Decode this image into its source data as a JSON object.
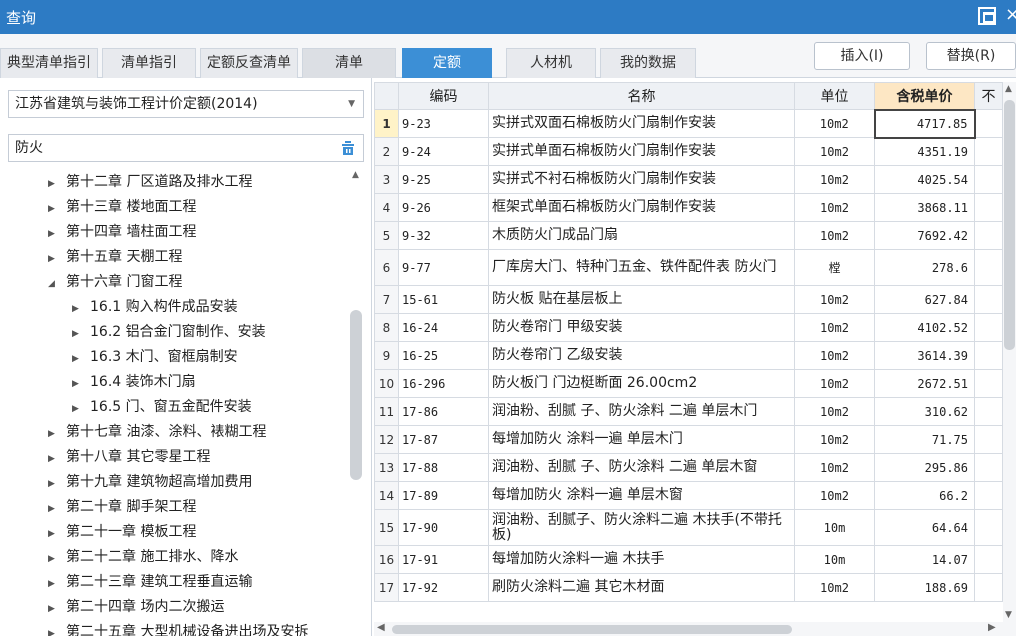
{
  "window": {
    "title": "查询"
  },
  "tabs": [
    {
      "label": "典型清单指引"
    },
    {
      "label": "清单指引"
    },
    {
      "label": "定额反查清单"
    },
    {
      "label": "清单"
    },
    {
      "label": "定额"
    },
    {
      "label": "人材机"
    },
    {
      "label": "我的数据"
    }
  ],
  "actions": {
    "insert": "插入(I)",
    "replace": "替换(R)"
  },
  "left": {
    "norm_select": "江苏省建筑与装饰工程计价定额(2014)",
    "search_value": "防火",
    "tree": [
      {
        "label": "第十二章 厂区道路及排水工程",
        "level": 0,
        "expanded": false
      },
      {
        "label": "第十三章 楼地面工程",
        "level": 0,
        "expanded": false
      },
      {
        "label": "第十四章 墙柱面工程",
        "level": 0,
        "expanded": false
      },
      {
        "label": "第十五章 天棚工程",
        "level": 0,
        "expanded": false
      },
      {
        "label": "第十六章 门窗工程",
        "level": 0,
        "expanded": true
      },
      {
        "label": "16.1 购入构件成品安装",
        "level": 1,
        "expanded": false
      },
      {
        "label": "16.2 铝合金门窗制作、安装",
        "level": 1,
        "expanded": false
      },
      {
        "label": "16.3 木门、窗框扇制安",
        "level": 1,
        "expanded": false
      },
      {
        "label": "16.4 装饰木门扇",
        "level": 1,
        "expanded": false
      },
      {
        "label": "16.5 门、窗五金配件安装",
        "level": 1,
        "expanded": false
      },
      {
        "label": "第十七章 油漆、涂料、裱糊工程",
        "level": 0,
        "expanded": false
      },
      {
        "label": "第十八章 其它零星工程",
        "level": 0,
        "expanded": false
      },
      {
        "label": "第十九章 建筑物超高增加费用",
        "level": 0,
        "expanded": false
      },
      {
        "label": "第二十章 脚手架工程",
        "level": 0,
        "expanded": false
      },
      {
        "label": "第二十一章 模板工程",
        "level": 0,
        "expanded": false
      },
      {
        "label": "第二十二章 施工排水、降水",
        "level": 0,
        "expanded": false
      },
      {
        "label": "第二十三章 建筑工程垂直运输",
        "level": 0,
        "expanded": false
      },
      {
        "label": "第二十四章 场内二次搬运",
        "level": 0,
        "expanded": false
      },
      {
        "label": "第二十五章 大型机械设备进出场及安拆",
        "level": 0,
        "expanded": false
      }
    ]
  },
  "table": {
    "headers": {
      "code": "编码",
      "name": "名称",
      "unit": "单位",
      "price": "含税单价",
      "extra": "不"
    },
    "rows": [
      {
        "no": "1",
        "code": "9-23",
        "name": "实拼式双面石棉板防火门扇制作安装",
        "unit": "10m2",
        "price": "4717.85"
      },
      {
        "no": "2",
        "code": "9-24",
        "name": "实拼式单面石棉板防火门扇制作安装",
        "unit": "10m2",
        "price": "4351.19"
      },
      {
        "no": "3",
        "code": "9-25",
        "name": "实拼式不衬石棉板防火门扇制作安装",
        "unit": "10m2",
        "price": "4025.54"
      },
      {
        "no": "4",
        "code": "9-26",
        "name": "框架式单面石棉板防火门扇制作安装",
        "unit": "10m2",
        "price": "3868.11"
      },
      {
        "no": "5",
        "code": "9-32",
        "name": "木质防火门成品门扇",
        "unit": "10m2",
        "price": "7692.42"
      },
      {
        "no": "6",
        "code": "9-77",
        "name": "厂库房大门、特种门五金、铁件配件表 防火门",
        "unit": "樘",
        "price": "278.6"
      },
      {
        "no": "7",
        "code": "15-61",
        "name": "防火板 贴在基层板上",
        "unit": "10m2",
        "price": "627.84"
      },
      {
        "no": "8",
        "code": "16-24",
        "name": "防火卷帘门 甲级安装",
        "unit": "10m2",
        "price": "4102.52"
      },
      {
        "no": "9",
        "code": "16-25",
        "name": "防火卷帘门 乙级安装",
        "unit": "10m2",
        "price": "3614.39"
      },
      {
        "no": "10",
        "code": "16-296",
        "name": "防火板门 门边梃断面 26.00cm2",
        "unit": "10m2",
        "price": "2672.51"
      },
      {
        "no": "11",
        "code": "17-86",
        "name": "润油粉、刮腻 子、防火涂料 二遍 单层木门",
        "unit": "10m2",
        "price": "310.62"
      },
      {
        "no": "12",
        "code": "17-87",
        "name": "每增加防火 涂料一遍 单层木门",
        "unit": "10m2",
        "price": "71.75"
      },
      {
        "no": "13",
        "code": "17-88",
        "name": "润油粉、刮腻 子、防火涂料 二遍 单层木窗",
        "unit": "10m2",
        "price": "295.86"
      },
      {
        "no": "14",
        "code": "17-89",
        "name": "每增加防火 涂料一遍 单层木窗",
        "unit": "10m2",
        "price": "66.2"
      },
      {
        "no": "15",
        "code": "17-90",
        "name": "润油粉、刮腻子、防火涂料二遍 木扶手(不带托板)",
        "unit": "10m",
        "price": "64.64"
      },
      {
        "no": "16",
        "code": "17-91",
        "name": "每增加防火涂料一遍 木扶手",
        "unit": "10m",
        "price": "14.07"
      },
      {
        "no": "17",
        "code": "17-92",
        "name": "刷防火涂料二遍 其它木材面",
        "unit": "10m2",
        "price": "188.69"
      }
    ]
  }
}
